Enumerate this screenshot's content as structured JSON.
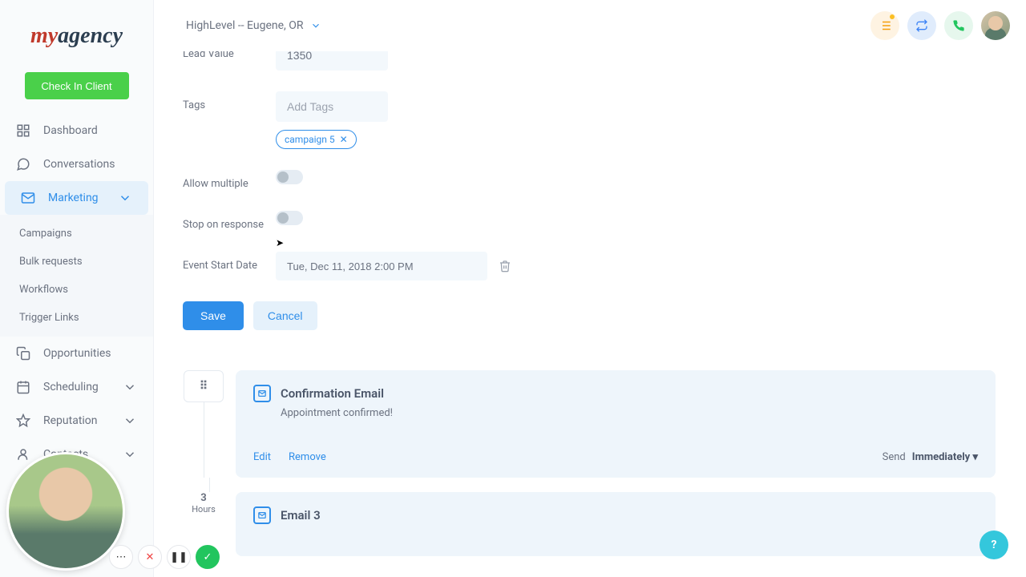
{
  "topbar": {
    "location": "HighLevel -- Eugene, OR"
  },
  "sidebar": {
    "logo_part1": "my",
    "logo_part2": "agency",
    "check_in": "Check In Client",
    "items": {
      "dashboard": "Dashboard",
      "conversations": "Conversations",
      "marketing": "Marketing",
      "opportunities": "Opportunities",
      "scheduling": "Scheduling",
      "reputation": "Reputation",
      "contacts": "Contacts"
    },
    "marketing_sub": {
      "campaigns": "Campaigns",
      "bulk_requests": "Bulk requests",
      "workflows": "Workflows",
      "trigger_links": "Trigger Links"
    }
  },
  "form": {
    "lead_value_label": "Lead Value",
    "lead_value": "1350",
    "tags_label": "Tags",
    "tags_placeholder": "Add Tags",
    "tag_pill": "campaign 5",
    "allow_multiple_label": "Allow multiple",
    "stop_on_response_label": "Stop on response",
    "event_start_label": "Event Start Date",
    "event_start_value": "Tue, Dec 11, 2018 2:00 PM",
    "save": "Save",
    "cancel": "Cancel"
  },
  "steps": {
    "confirmation": {
      "title": "Confirmation Email",
      "subtitle": "Appointment confirmed!",
      "edit": "Edit",
      "remove": "Remove",
      "send_label": "Send",
      "send_value": "Immediately"
    },
    "email3": {
      "title": "Email 3",
      "badge_num": "3",
      "badge_unit": "Hours"
    }
  },
  "help": "?"
}
